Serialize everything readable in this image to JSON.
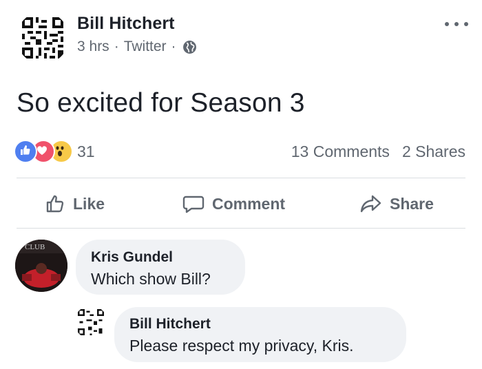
{
  "post": {
    "author": "Bill Hitchert",
    "time": "3 hrs",
    "source": "Twitter",
    "text": "So excited for Season 3",
    "reaction_count": "31",
    "comments_count": "13 Comments",
    "shares_count": "2 Shares",
    "reactions": [
      "like-icon",
      "love-icon",
      "wow-icon"
    ]
  },
  "actions": {
    "like": "Like",
    "comment": "Comment",
    "share": "Share"
  },
  "comments": [
    {
      "author": "Kris Gundel",
      "text": "Which show Bill?",
      "avatar_text": "CLUB"
    },
    {
      "author": "Bill Hitchert",
      "text": "Please respect my privacy, Kris."
    }
  ],
  "colors": {
    "like_blue": "#4f7ff0",
    "love_red": "#f0526b",
    "wow_yellow": "#f7c948",
    "secondary_text": "#606770",
    "bubble_bg": "#f0f2f5"
  }
}
